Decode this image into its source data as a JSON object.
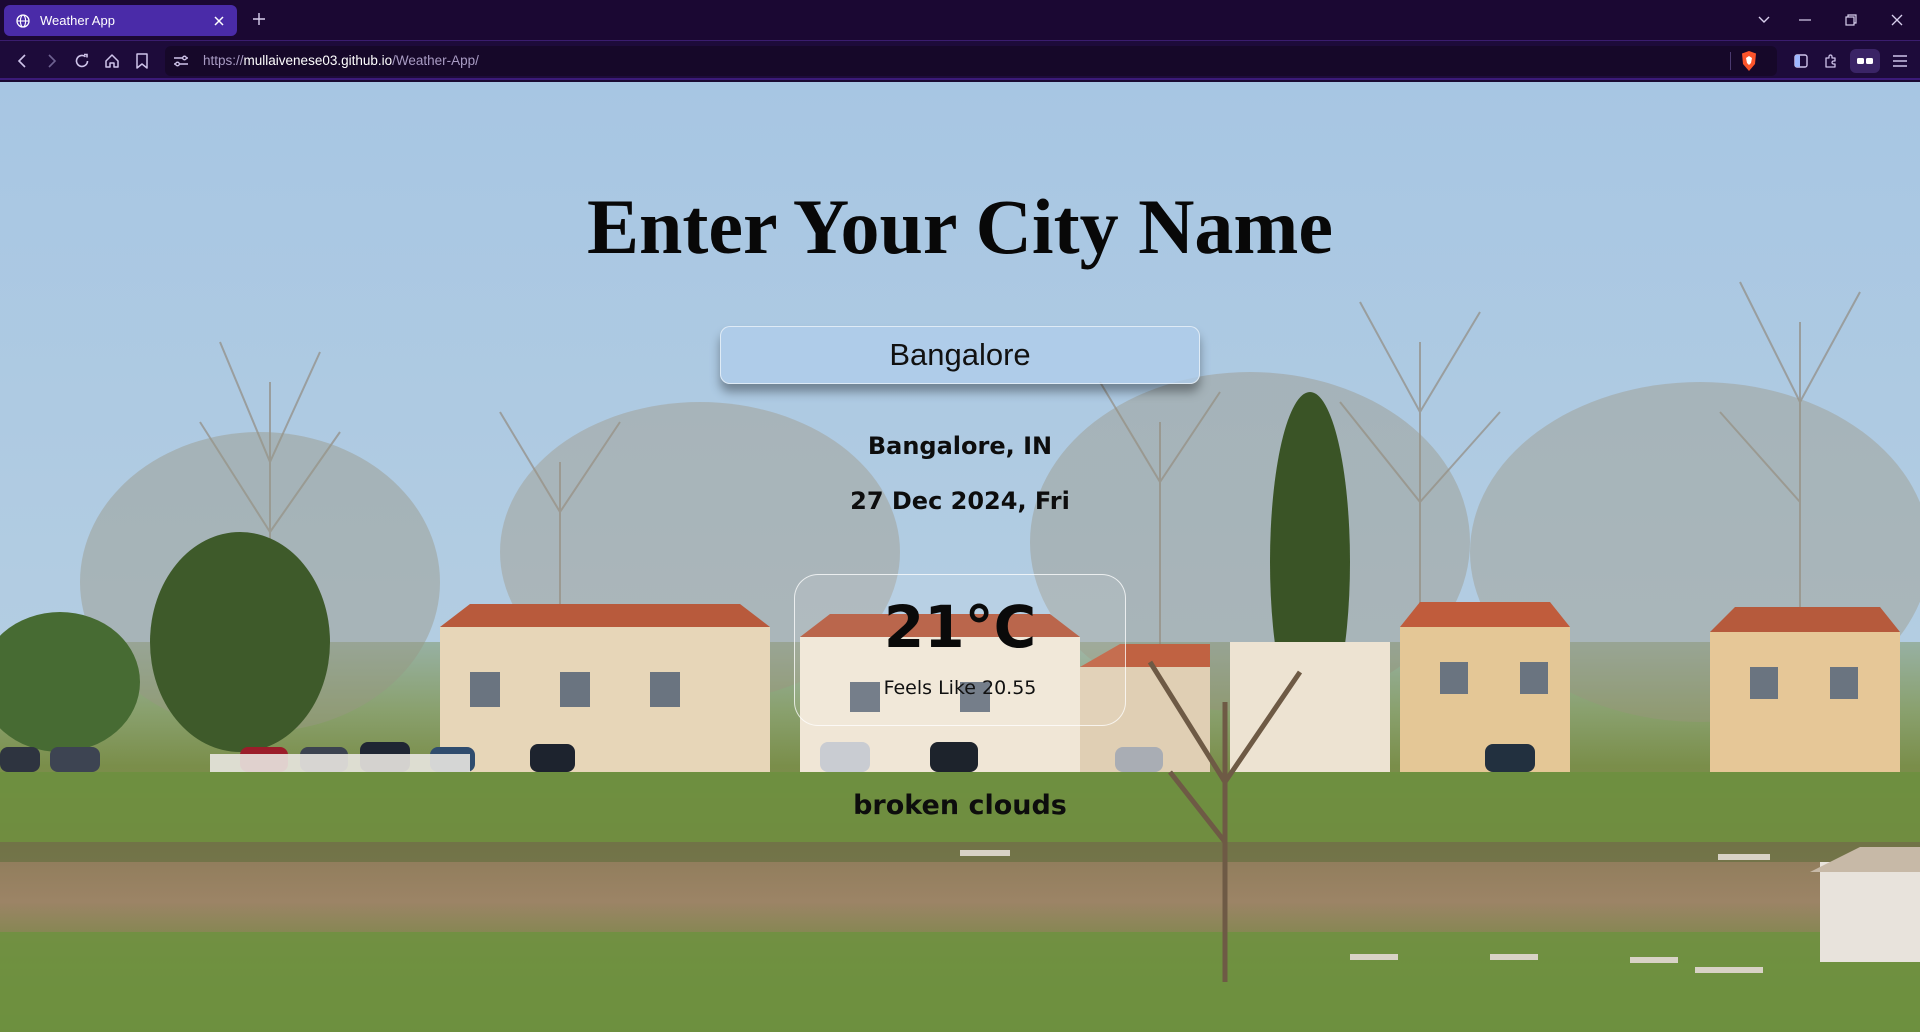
{
  "browser": {
    "tab_title": "Weather App",
    "url_scheme": "https://",
    "url_host": "mullaivenese03.github.io",
    "url_path": "/Weather-App/"
  },
  "icons": {
    "back": "back-arrow-icon",
    "forward": "forward-arrow-icon",
    "reload": "reload-icon",
    "home": "home-icon",
    "bookmark": "bookmark-icon",
    "site_info": "site-settings-icon",
    "brave": "brave-shield-icon",
    "sidebar": "sidebar-icon",
    "extensions": "extensions-icon",
    "wallet": "wallet-icon",
    "menu": "menu-icon"
  },
  "page": {
    "heading": "Enter Your City Name",
    "search_value": "Bangalore",
    "location": "Bangalore, IN",
    "date": "27 Dec 2024, Fri",
    "temperature": "21°C",
    "feels_like": "Feels Like 20.55",
    "condition": "broken clouds"
  },
  "colors": {
    "tab_active": "#4a2ba8",
    "chrome_bg": "#1b0833",
    "sky": "#a8c6e2",
    "grass": "#6f8a40"
  }
}
